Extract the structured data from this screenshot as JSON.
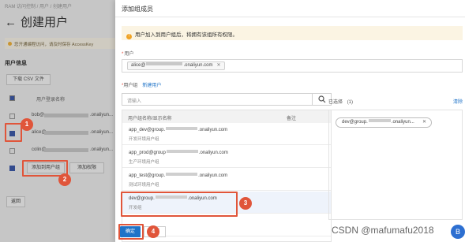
{
  "background": {
    "breadcrumb": "RAM 访问控制 / 用户 / 创建用户",
    "title": "创建用户",
    "notice": "您开通编程访问，请及时保存 AccessKey",
    "section": "用户信息",
    "download_csv": "下载 CSV 文件",
    "table_header": "用户登录名称",
    "users": [
      {
        "name": "bob@",
        "domain": ".onaliyun...",
        "checked": false
      },
      {
        "name": "alice@",
        "domain": ".onaliyun...",
        "checked": true
      },
      {
        "name": "colin@",
        "domain": ".onaliyun...",
        "checked": false
      }
    ],
    "add_to_group": "添加到用户组",
    "add_permission": "添加权限",
    "back": "返回"
  },
  "drawer": {
    "title": "添加组成员",
    "tip": "用户加入到用户组后，将拥有该组所有权限。",
    "user_label": "用户",
    "user_tag": {
      "prefix": "alice@",
      "suffix": ".onaliyun.com"
    },
    "group_label": "用户组",
    "new_group": "新建用户",
    "search_placeholder": "请输入",
    "col_name": "用户组名称/显示名称",
    "col_note": "备注",
    "groups": [
      {
        "prefix": "app_dev@group.",
        "suffix": ".onaliyun.com",
        "desc": "开发环境用户组"
      },
      {
        "prefix": "app_prod@group",
        "suffix": ".onaliyun.com",
        "desc": "生产环境用户组"
      },
      {
        "prefix": "app_test@group.",
        "suffix": ".onaliyun.com",
        "desc": "测试环境用户组"
      },
      {
        "prefix": "dev@group.",
        "suffix": ".onaliyun.com",
        "desc": "开发组"
      },
      {
        "prefix": "",
        "suffix": "",
        "desc": ""
      }
    ],
    "selected_label": "已选择",
    "selected_count": "(1)",
    "clear": "清除",
    "selected_tag": {
      "prefix": "dev@group.",
      "suffix": ".onaliyun..."
    },
    "ok": "确定",
    "cancel": "取消"
  },
  "annotations": {
    "n1": "1",
    "n2": "2",
    "n3": "3",
    "n4": "4"
  },
  "watermark": "CSDN @mafumafu2018",
  "watermark_badge": "B",
  "colors": {
    "accent": "#1f73c8",
    "annotation": "#e0553a",
    "tip_bg": "#fbf4e3"
  }
}
